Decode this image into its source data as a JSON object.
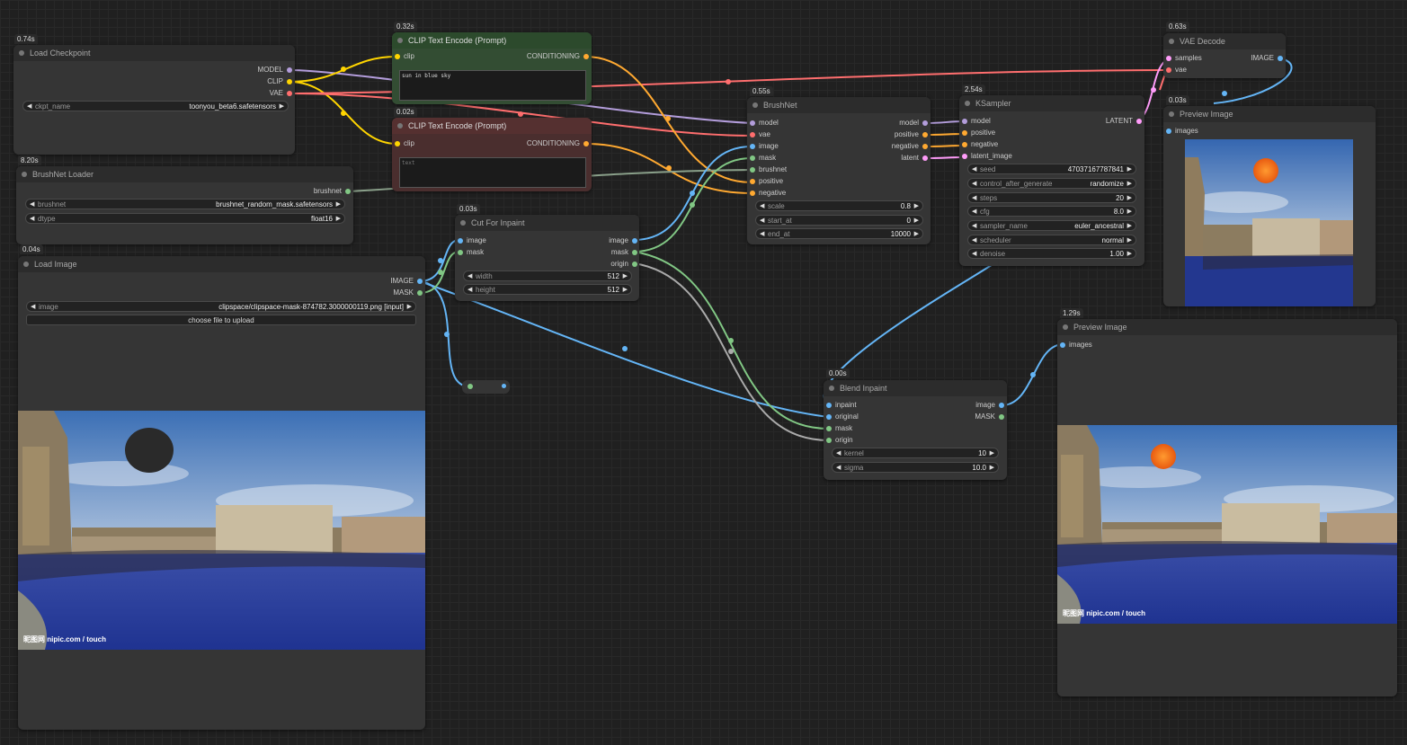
{
  "colors": {
    "model": "#b39ddb",
    "clip": "#ffd500",
    "vae": "#ff6e6e",
    "conditioning": "#ffa931",
    "image": "#64b5f6",
    "mask": "#81c784",
    "latent": "#ff9cf9",
    "brushnet": "#81c784"
  },
  "load_checkpoint": {
    "time": "0.74s",
    "title": "Load Checkpoint",
    "outputs": [
      "MODEL",
      "CLIP",
      "VAE"
    ],
    "ckpt_name_label": "ckpt_name",
    "ckpt_name_value": "toonyou_beta6.safetensors"
  },
  "clip_pos": {
    "time": "0.32s",
    "title": "CLIP Text Encode (Prompt)",
    "input": "clip",
    "output": "CONDITIONING",
    "text": "sun in blue sky"
  },
  "clip_neg": {
    "time": "0.02s",
    "title": "CLIP Text Encode (Prompt)",
    "input": "clip",
    "output": "CONDITIONING",
    "text": "text"
  },
  "brushnet_loader": {
    "time": "8.20s",
    "title": "BrushNet Loader",
    "output": "brushnet",
    "brushnet_label": "brushnet",
    "brushnet_value": "brushnet_random_mask.safetensors",
    "dtype_label": "dtype",
    "dtype_value": "float16"
  },
  "load_image": {
    "time": "0.04s",
    "title": "Load Image",
    "outputs": [
      "IMAGE",
      "MASK"
    ],
    "image_label": "image",
    "image_value": "clipspace/clipspace-mask-874782.3000000119.png [input]",
    "upload_label": "choose file to upload",
    "watermark": "昵图网 nipic.com / touch"
  },
  "cut_inpaint": {
    "time": "0.03s",
    "title": "Cut For Inpaint",
    "inputs": [
      "image",
      "mask"
    ],
    "outputs": [
      "image",
      "mask",
      "origin"
    ],
    "width_label": "width",
    "width_value": "512",
    "height_label": "height",
    "height_value": "512"
  },
  "brushnet": {
    "time": "0.55s",
    "title": "BrushNet",
    "inputs": [
      "model",
      "vae",
      "image",
      "mask",
      "brushnet",
      "positive",
      "negative"
    ],
    "outputs": [
      "model",
      "positive",
      "negative",
      "latent"
    ],
    "scale_label": "scale",
    "scale_value": "0.8",
    "start_label": "start_at",
    "start_value": "0",
    "end_label": "end_at",
    "end_value": "10000"
  },
  "ksampler": {
    "time": "2.54s",
    "title": "KSampler",
    "inputs": [
      "model",
      "positive",
      "negative",
      "latent_image"
    ],
    "output": "LATENT",
    "widgets": [
      {
        "label": "seed",
        "value": "47037167787841"
      },
      {
        "label": "control_after_generate",
        "value": "randomize"
      },
      {
        "label": "steps",
        "value": "20"
      },
      {
        "label": "cfg",
        "value": "8.0"
      },
      {
        "label": "sampler_name",
        "value": "euler_ancestral"
      },
      {
        "label": "scheduler",
        "value": "normal"
      },
      {
        "label": "denoise",
        "value": "1.00"
      }
    ]
  },
  "vae_decode": {
    "time": "0.63s",
    "title": "VAE Decode",
    "inputs": [
      "samples",
      "vae"
    ],
    "output": "IMAGE"
  },
  "preview1": {
    "time": "0.03s",
    "title": "Preview Image",
    "input": "images"
  },
  "preview2": {
    "time": "1.29s",
    "title": "Preview Image",
    "input": "images",
    "watermark": "昵图网 nipic.com / touch"
  },
  "blend": {
    "time": "0.00s",
    "title": "Blend Inpaint",
    "inputs": [
      "inpaint",
      "original",
      "mask",
      "origin"
    ],
    "outputs": [
      "image",
      "MASK"
    ],
    "kernel_label": "kernel",
    "kernel_value": "10",
    "sigma_label": "sigma",
    "sigma_value": "10.0"
  },
  "icons": {
    "widget_left": "◀",
    "widget_right": "▶"
  }
}
